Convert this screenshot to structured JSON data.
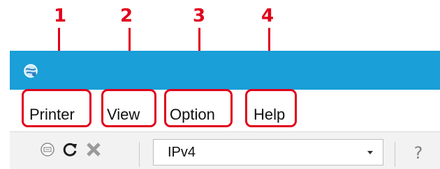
{
  "callouts": [
    "1",
    "2",
    "3",
    "4"
  ],
  "menu": {
    "items": [
      {
        "label": "Printer"
      },
      {
        "label": "View"
      },
      {
        "label": "Option"
      },
      {
        "label": "Help"
      }
    ]
  },
  "toolbar": {
    "protocol_value": "IPv4",
    "icons": [
      "search-printer-icon",
      "refresh-icon",
      "cancel-icon",
      "help-icon"
    ]
  },
  "colors": {
    "titlebar": "#1a9fd8",
    "callout_red": "#e0001b"
  }
}
